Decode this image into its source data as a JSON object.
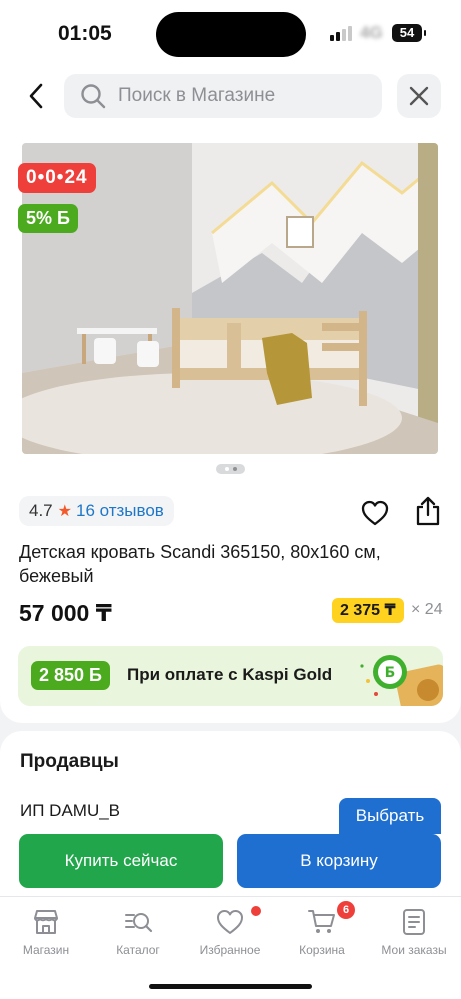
{
  "status": {
    "time": "01:05",
    "network": "4G",
    "battery": "54"
  },
  "header": {
    "search_placeholder": "Поиск в Магазине"
  },
  "product": {
    "badges": {
      "timer": "0•0•24",
      "bonus": "5% Б"
    },
    "rating": "4.7",
    "reviews": "16 отзывов",
    "title": "Детская кровать Scandi 365150, 80x160 см, бежевый",
    "price": "57 000 ₸",
    "installment": {
      "amount": "2 375 ₸",
      "months": "× 24"
    },
    "kaspi_gold": {
      "bonus": "2 850 Б",
      "text": "При оплате с Kaspi Gold"
    }
  },
  "sellers": {
    "title": "Продавцы",
    "seller_name": "ИП DAMU_B",
    "select_label": "Выбрать"
  },
  "actions": {
    "buy_now": "Купить сейчас",
    "to_cart": "В корзину"
  },
  "tabbar": {
    "items": [
      {
        "label": "Магазин",
        "icon": "shop-icon"
      },
      {
        "label": "Каталог",
        "icon": "catalog-icon"
      },
      {
        "label": "Избранное",
        "icon": "heart-icon"
      },
      {
        "label": "Корзина",
        "icon": "cart-icon"
      },
      {
        "label": "Мои заказы",
        "icon": "orders-icon"
      }
    ],
    "cart_count": "6"
  },
  "colors": {
    "accent_blue": "#1f6fd1",
    "buy_green": "#22a64b",
    "bonus_green": "#4caa1f",
    "timer_red": "#ef3f3a",
    "installment_yellow": "#ffd21f"
  }
}
